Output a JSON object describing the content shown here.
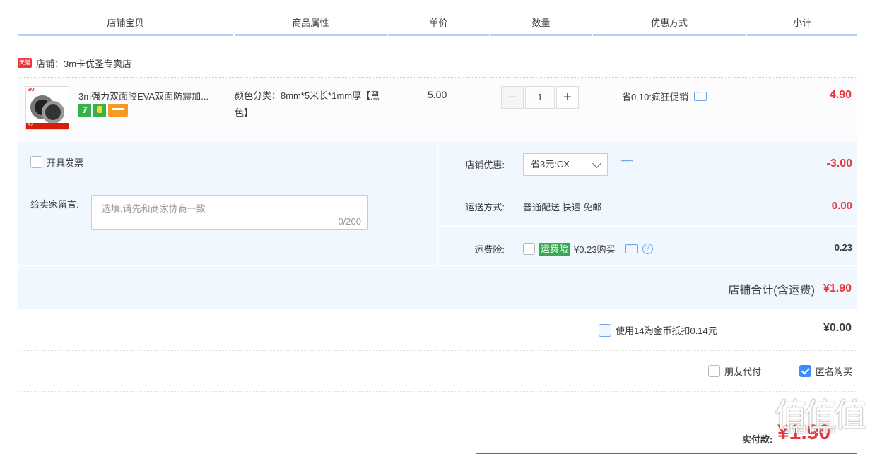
{
  "header": {
    "columns": [
      "店铺宝贝",
      "商品属性",
      "单价",
      "数量",
      "优惠方式",
      "小计"
    ]
  },
  "shop": {
    "badge": "天猫",
    "label": "店铺：3m卡优圣专卖店"
  },
  "item": {
    "title": "3m强力双面胶EVA双面防震加...",
    "badges": [
      "7"
    ],
    "thumb_label": "3M",
    "thumb_price": "5.8",
    "attributes": "颜色分类：8mm*5米长*1mm厚【黑色】",
    "price": "5.00",
    "quantity": "1",
    "minus": "−",
    "plus": "+",
    "promotion": "省0.10:疯狂促销",
    "subtotal": "4.90"
  },
  "options": {
    "invoice_label": "开具发票",
    "message_label": "给卖家留言:",
    "message_placeholder": "选填,请先和商家协商一致",
    "message_count": "0/200",
    "shop_discount_label": "店铺优惠:",
    "shop_discount_value": "省3元:CX",
    "shop_discount_amount": "-3.00",
    "shipping_label": "运送方式:",
    "shipping_value": "普通配送 快递 免邮",
    "shipping_amount": "0.00",
    "insurance_label": "运费险:",
    "insurance_badge": "运费险",
    "insurance_text": "¥0.23购买",
    "insurance_amount": "0.23",
    "insurance_help": "?",
    "shop_total_label": "店铺合计(含运费)",
    "shop_total_value": "¥1.90"
  },
  "coins": {
    "label": "使用14淘金币抵扣0.14元",
    "value": "¥0.00"
  },
  "extra": {
    "friend_pay": "朋友代付",
    "friend_pay_checked": false,
    "anonymous": "匿名购买",
    "anonymous_checked": true
  },
  "payment": {
    "label": "实付款:",
    "amount": "¥1.90"
  },
  "watermark": {
    "text": "值值值",
    "site": "zhizhi.com"
  },
  "colors": {
    "accent": "#e4393c",
    "header_line": "#b2d1ff",
    "panel": "#f1f7ff",
    "checkbox": "#3d8bfd"
  }
}
